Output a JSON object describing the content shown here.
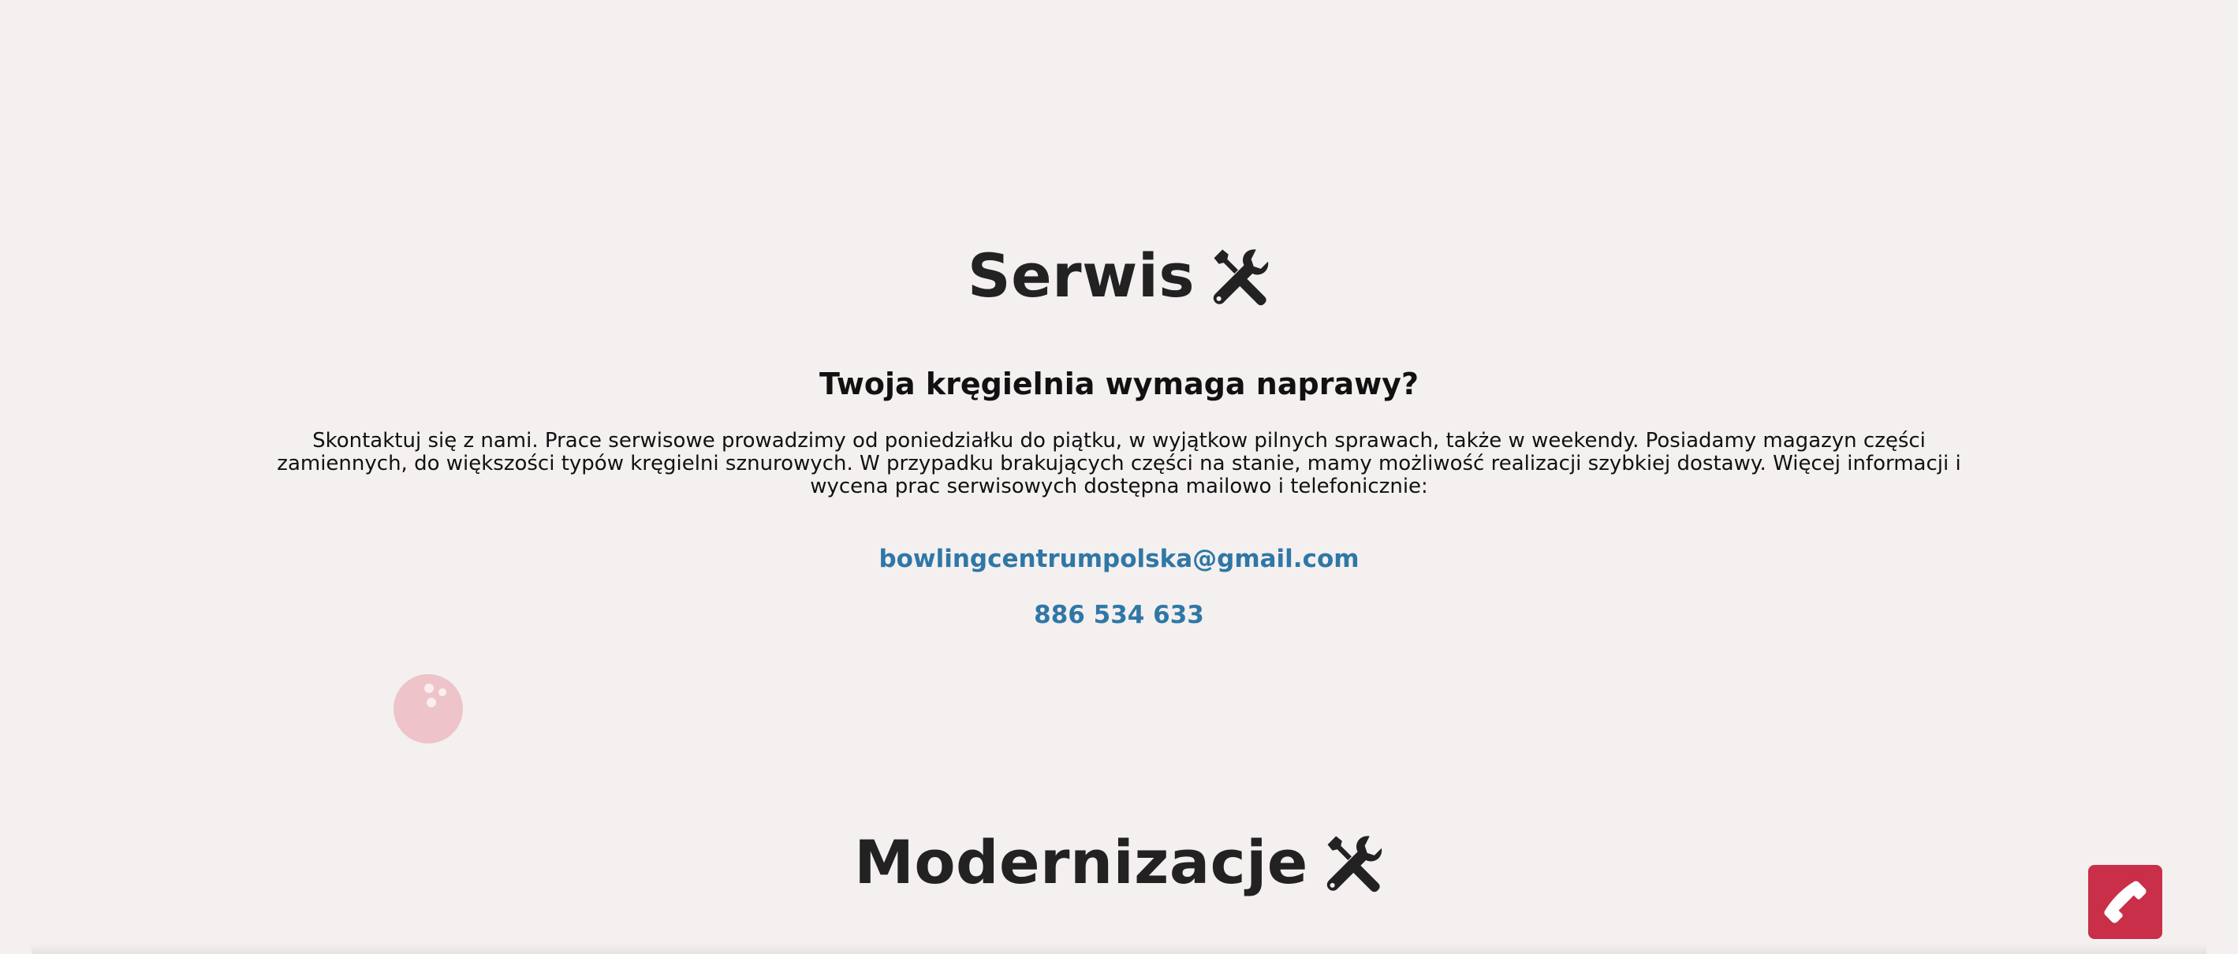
{
  "serwis": {
    "title": "Serwis",
    "icon": "tools-icon",
    "subheading": "Twoja kręgielnia wymaga naprawy?",
    "body": "Skontaktuj się z nami. Prace serwisowe prowadzimy od poniedziałku do piątku, w wyjątkow pilnych sprawach, także w weekendy. Posiadamy magazyn części zamiennych, do większości typów kręgielni sznurowych. W przypadku brakujących części na stanie, mamy możliwość realizacji szybkiej dostawy. Więcej informacji i wycena prac serwisowych dostępna mailowo i telefonicznie:",
    "email": "bowlingcentrumpolska@gmail.com",
    "phone": "886 534 633"
  },
  "modernizacje": {
    "title": "Modernizacje",
    "icon": "tools-icon"
  },
  "decoration": {
    "icon": "bowling-ball-icon"
  },
  "phone_button": {
    "icon": "phone-icon"
  },
  "colors": {
    "background": "#f4f0f0",
    "heading": "#222222",
    "link": "#2f77a6",
    "accent": "#c92f48",
    "bowling_ball": "#eec3c9"
  }
}
